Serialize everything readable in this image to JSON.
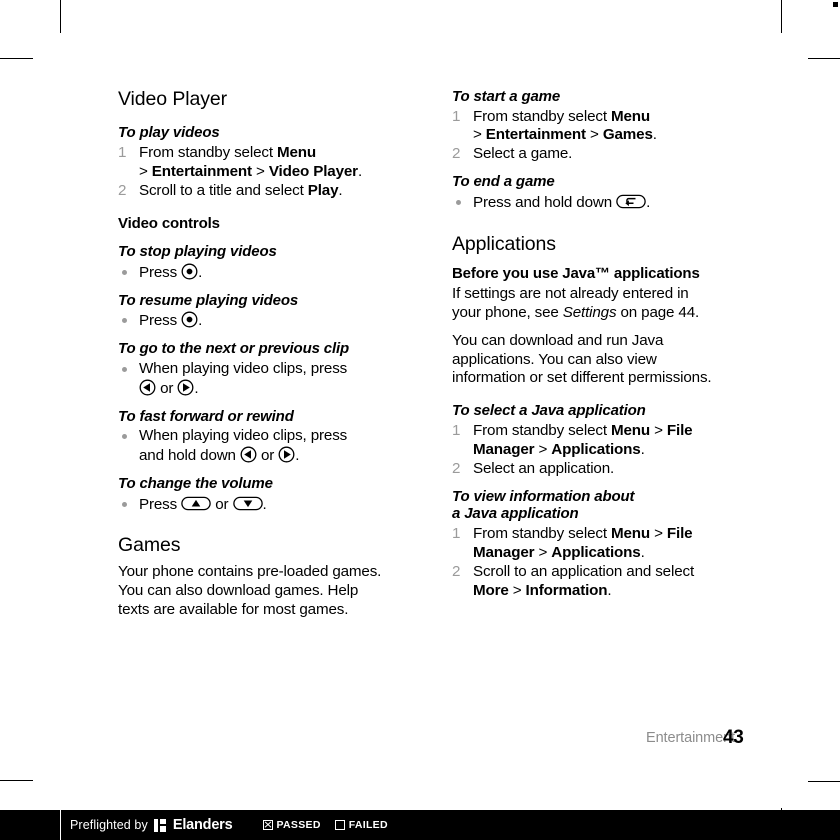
{
  "page": {
    "running_head": "Entertainment",
    "page_number": "43"
  },
  "left_column": {
    "section_title": "Video Player",
    "task_play_videos": {
      "heading": "To play videos",
      "steps": [
        {
          "num": "1",
          "line1_pre": "From standby select ",
          "line1_bold": "Menu",
          "line2_gt1": "> ",
          "line2_bold1": "Entertainment",
          "line2_gt2": " > ",
          "line2_bold2": "Video Player",
          "line2_post": "."
        },
        {
          "num": "2",
          "pre": "Scroll to a title and select ",
          "bold": "Play",
          "post": "."
        }
      ]
    },
    "video_controls_heading": "Video controls",
    "task_stop": {
      "heading": "To stop playing videos",
      "press_label": "Press ",
      "key": "center-select-key",
      "post": "."
    },
    "task_resume": {
      "heading": "To resume playing videos",
      "press_label": "Press ",
      "key": "center-select-key",
      "post": "."
    },
    "task_next_prev": {
      "heading": "To go to the next or previous clip",
      "line1": "When playing video clips, press",
      "key_left": "nav-left-key",
      "or": " or ",
      "key_right": "nav-right-key",
      "post": "."
    },
    "task_ff_rew": {
      "heading": "To fast forward or rewind",
      "line1": "When playing video clips, press",
      "line2": "and hold down ",
      "key_left": "nav-left-key",
      "or": " or ",
      "key_right": "nav-right-key",
      "post": "."
    },
    "task_volume": {
      "heading": "To change the volume",
      "press_label": "Press ",
      "key_up": "volume-up-key",
      "or": " or ",
      "key_down": "volume-down-key",
      "post": "."
    },
    "games": {
      "section_title": "Games",
      "body": "Your phone contains pre-loaded games. You can also download games. Help texts are available for most games."
    }
  },
  "right_column": {
    "task_start_game": {
      "heading": "To start a game",
      "steps": [
        {
          "num": "1",
          "line1_pre": "From standby select ",
          "line1_bold": "Menu",
          "line2_gt1": "> ",
          "line2_bold1": "Entertainment",
          "line2_gt2": " > ",
          "line2_bold2": "Games",
          "line2_post": "."
        },
        {
          "num": "2",
          "pre": "Select a game.",
          "bold": "",
          "post": ""
        }
      ]
    },
    "task_end_game": {
      "heading": "To end a game",
      "press_label": "Press and hold down ",
      "key": "back-return-key",
      "post": "."
    },
    "applications": {
      "section_title": "Applications",
      "before_heading": "Before you use Java™ applications",
      "before_body_pre": "If settings are not already entered in your phone, see ",
      "before_body_italic": "Settings",
      "before_body_post": " on page 44.",
      "body2": "You can download and run Java applications. You can also view information or set different permissions."
    },
    "task_select_java": {
      "heading": "To select a Java application",
      "steps": [
        {
          "num": "1",
          "line1_pre": "From standby select ",
          "line1_bold1": "Menu",
          "line1_gt": " > ",
          "line1_bold2": "File",
          "line2_bold1": "Manager",
          "line2_gt": " > ",
          "line2_bold2": "Applications",
          "line2_post": "."
        },
        {
          "num": "2",
          "pre": "Select an application.",
          "bold": "",
          "post": ""
        }
      ]
    },
    "task_view_info": {
      "heading_line1": "To view information about",
      "heading_line2": "a Java application",
      "steps": [
        {
          "num": "1",
          "line1_pre": "From standby select ",
          "line1_bold1": "Menu",
          "line1_gt": " > ",
          "line1_bold2": "File",
          "line2_bold1": "Manager",
          "line2_gt": " > ",
          "line2_bold2": "Applications",
          "line2_post": "."
        },
        {
          "num": "2",
          "line1": "Scroll to an application and select",
          "line2_bold1": "More",
          "line2_gt": " > ",
          "line2_bold2": "Information",
          "line2_post": "."
        }
      ]
    }
  },
  "preflight_bar": {
    "prefix": "Preflighted by",
    "logo_text": "Elanders",
    "passed_label": "PASSED",
    "failed_label": "FAILED",
    "passed_checked": true,
    "failed_checked": false
  }
}
